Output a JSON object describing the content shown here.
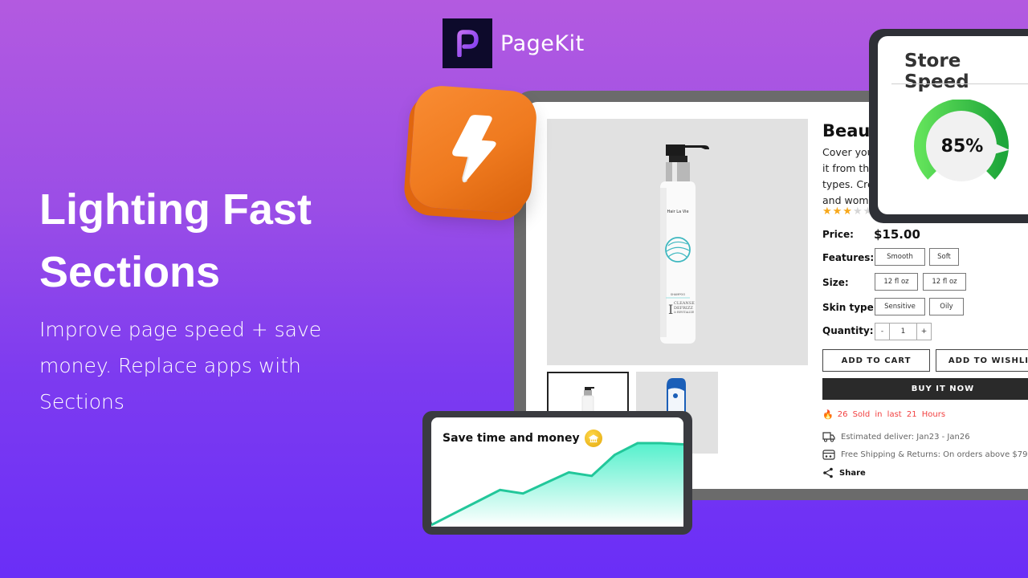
{
  "brand": {
    "name": "PageKit",
    "logo_letter": "P"
  },
  "hero": {
    "title_line1": "Lighting Fast",
    "title_line2": "Sections",
    "subtitle": "Improve page speed + save money. Replace apps with Sections"
  },
  "product": {
    "title": "Beaut",
    "description": "Cover you... it from the... types. Crea... and wome...",
    "description_lines": [
      "Cover you",
      "it from the",
      "types. Crea",
      "and wome"
    ],
    "rating": {
      "value": 3,
      "max": 5,
      "stars_on": "★★★",
      "stars_off": "★★"
    },
    "labels": {
      "price": "Price:",
      "features": "Features:",
      "size": "Size:",
      "skin_type": "Skin type:",
      "quantity": "Quantity:"
    },
    "price": "$15.00",
    "features": [
      "Smooth",
      "Soft"
    ],
    "sizes": [
      "12 fl oz",
      "12 fl oz"
    ],
    "skin_types": [
      "Sensitive",
      "Oily"
    ],
    "quantity": {
      "minus": "-",
      "value": "1",
      "plus": "+"
    },
    "buttons": {
      "add_to_cart": "ADD TO CART",
      "add_to_wishlist": "ADD TO WISHLIS",
      "buy_now": "BUY IT NOW"
    },
    "sold_text": "26 Sold in last 21 Hours",
    "delivery_text": "Estimated deliver: Jan23 - Jan26",
    "shipping_text": "Free Shipping & Returns: On orders above $79",
    "share_label": "Share",
    "image_label": "Hair La Vie shampoo bottle"
  },
  "speed_card": {
    "title": "Store Speed",
    "value_label": "85%",
    "percent": 85,
    "color": "#3cc94a"
  },
  "money_card": {
    "title": "Save time and money",
    "chart_values": [
      0,
      10,
      20,
      30,
      27,
      36,
      45,
      42,
      60,
      70,
      70,
      69
    ],
    "color": "#2fcfa4"
  },
  "colors": {
    "bg_top": "#b35ae0",
    "bg_bottom": "#6a2ef7",
    "accent_orange": "#ef7a1f",
    "alert_red": "#f24040",
    "star": "#f7a81b"
  }
}
